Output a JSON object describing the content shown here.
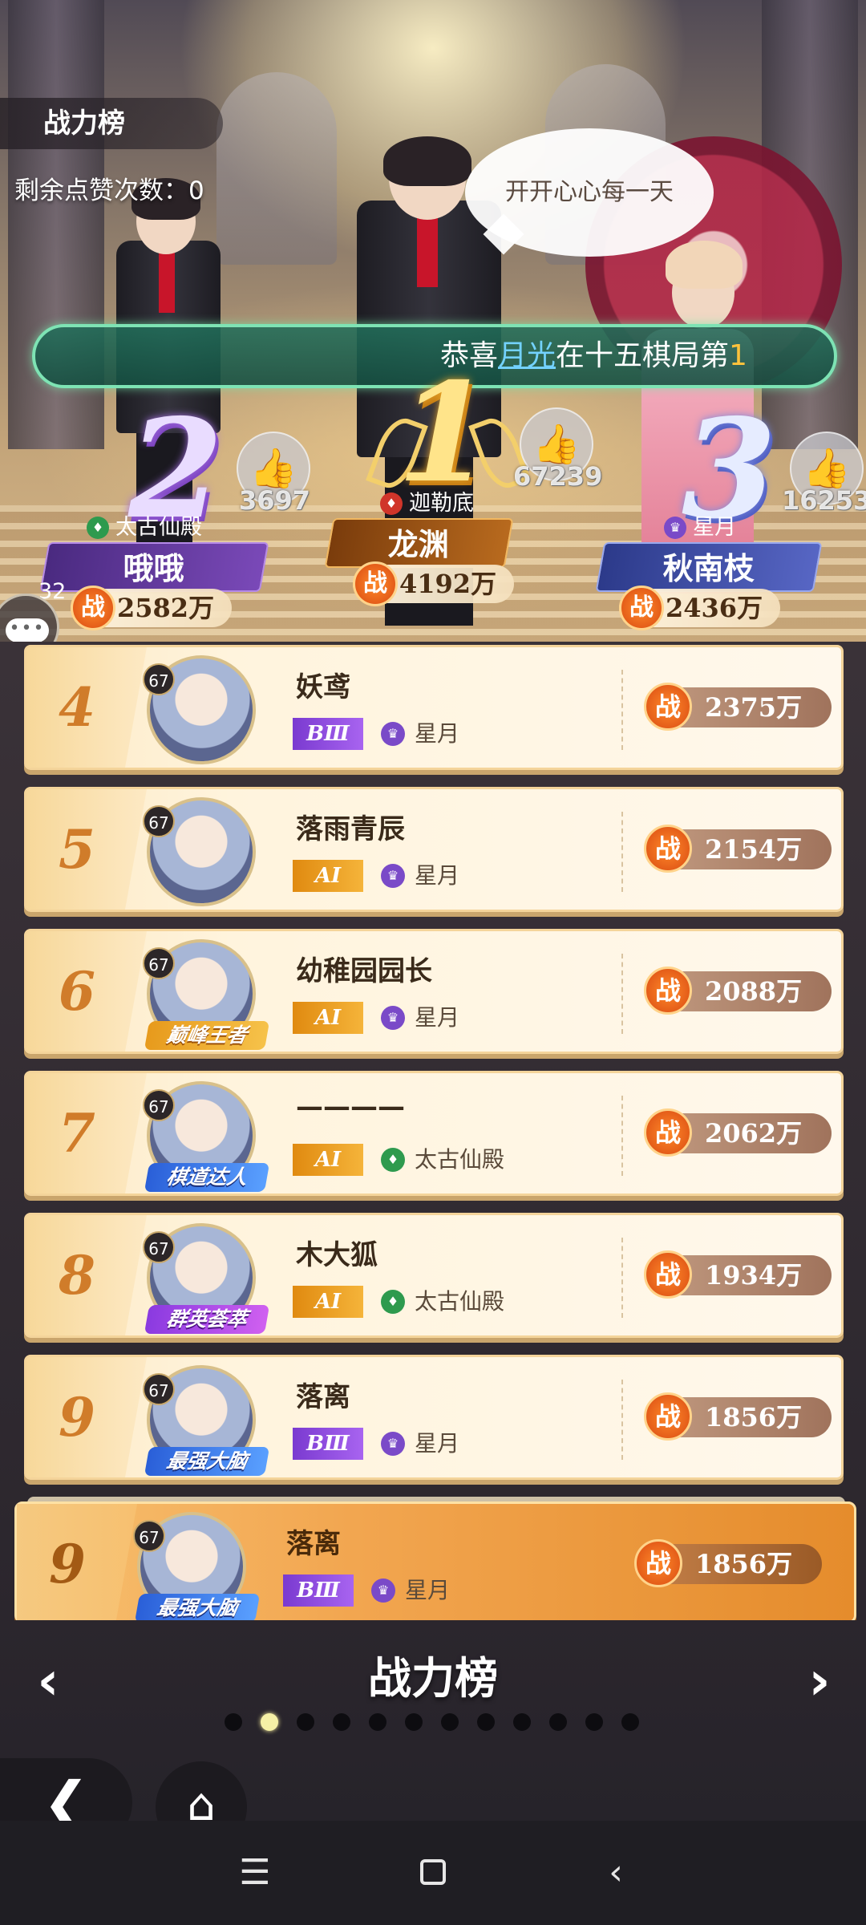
{
  "header": {
    "title": "战力榜",
    "likes_remaining": "剩余点赞次数：0",
    "speech": "开开心心每一天"
  },
  "ticker": {
    "prefix": "恭喜",
    "name": "月光",
    "middle": "在十五棋局第",
    "num": "1"
  },
  "podium": [
    {
      "rank": "2",
      "guild": "太古仙殿",
      "name": "哦哦",
      "power": "2582万",
      "likes": "3697"
    },
    {
      "rank": "1",
      "guild": "迦勒底",
      "name": "龙渊",
      "power": "4192万",
      "likes": "67239"
    },
    {
      "rank": "3",
      "guild": "星月",
      "name": "秋南枝",
      "power": "2436万",
      "likes": "16253"
    }
  ],
  "power_badge": "战",
  "chat_count": "32",
  "rows": [
    {
      "rank": "4",
      "level": "67",
      "name": "妖鸢",
      "tier": "BⅢ",
      "guild": "星月",
      "power": "2375万",
      "title": ""
    },
    {
      "rank": "5",
      "level": "67",
      "name": "落雨青辰",
      "tier": "AⅠ",
      "guild": "星月",
      "power": "2154万",
      "title": ""
    },
    {
      "rank": "6",
      "level": "67",
      "name": "幼稚园园长",
      "tier": "AⅠ",
      "guild": "星月",
      "power": "2088万",
      "title": "巅峰王者"
    },
    {
      "rank": "7",
      "level": "67",
      "name": "————",
      "tier": "AⅠ",
      "guild": "太古仙殿",
      "power": "2062万",
      "title": "棋道达人"
    },
    {
      "rank": "8",
      "level": "67",
      "name": "木大狐",
      "tier": "AⅠ",
      "guild": "太古仙殿",
      "power": "1934万",
      "title": "群英荟萃"
    },
    {
      "rank": "9",
      "level": "67",
      "name": "落离",
      "tier": "BⅢ",
      "guild": "星月",
      "power": "1856万",
      "title": "最强大脑"
    }
  ],
  "self": {
    "rank": "9",
    "level": "67",
    "name": "落离",
    "tier": "BⅢ",
    "guild": "星月",
    "power": "1856万",
    "title": "最强大脑"
  },
  "footer": {
    "title": "战力榜",
    "prev": "‹",
    "next": "›",
    "page_count": 12,
    "active_page": 2
  },
  "icons": {
    "like": "thumbs-up-icon",
    "back": "back-arrow-icon",
    "home": "home-icon",
    "guild": "guild-crown-icon"
  },
  "colors": {
    "accent_orange": "#e58c2c",
    "ticker_green": "#7ee3b4",
    "rank_text": "#d07c2a"
  }
}
